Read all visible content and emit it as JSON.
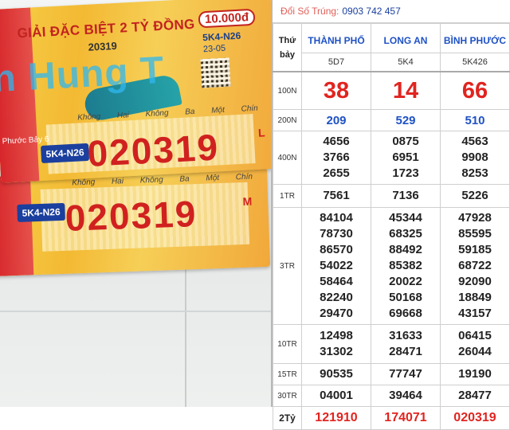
{
  "ticket": {
    "header": "GIẢI ĐẶC BIỆT 2 TỶ ĐỒNG",
    "price": "10.000đ",
    "code_small": "5K4-N26",
    "number_small": "20319",
    "date_partial": "23-05",
    "watermark": "n Hung T",
    "days": "Không Hai Không Ba Một Chín",
    "side_text": "Phước Bảy 6",
    "series": "5K4-N26",
    "number": "020319",
    "suffix_top": "L",
    "suffix_bottom": "M"
  },
  "results": {
    "title_label": "Đổi Số Trúng:",
    "phone": "0903 742 457",
    "day_label": "Thứ bảy",
    "provinces": [
      {
        "name": "THÀNH PHỐ",
        "code": "5D7"
      },
      {
        "name": "LONG AN",
        "code": "5K4"
      },
      {
        "name": "BÌNH PHƯỚC",
        "code": "5K426"
      }
    ],
    "prizes": [
      {
        "label": "100N",
        "values": [
          [
            "38"
          ],
          [
            "14"
          ],
          [
            "66"
          ]
        ]
      },
      {
        "label": "200N",
        "values": [
          [
            "209"
          ],
          [
            "529"
          ],
          [
            "510"
          ]
        ]
      },
      {
        "label": "400N",
        "values": [
          [
            "4656",
            "3766",
            "2655"
          ],
          [
            "0875",
            "6951",
            "1723"
          ],
          [
            "4563",
            "9908",
            "8253"
          ]
        ]
      },
      {
        "label": "1TR",
        "values": [
          [
            "7561"
          ],
          [
            "7136"
          ],
          [
            "5226"
          ]
        ]
      },
      {
        "label": "3TR",
        "values": [
          [
            "84104",
            "78730",
            "86570",
            "54022",
            "58464",
            "82240",
            "29470"
          ],
          [
            "45344",
            "68325",
            "88492",
            "85382",
            "20022",
            "50168",
            "69668"
          ],
          [
            "47928",
            "85595",
            "59185",
            "68722",
            "92090",
            "18849",
            "43157"
          ]
        ]
      },
      {
        "label": "10TR",
        "values": [
          [
            "12498",
            "31302"
          ],
          [
            "31633",
            "28471"
          ],
          [
            "06415",
            "26044"
          ]
        ]
      },
      {
        "label": "15TR",
        "values": [
          [
            "90535"
          ],
          [
            "77747"
          ],
          [
            "19190"
          ]
        ]
      },
      {
        "label": "30TR",
        "values": [
          [
            "04001"
          ],
          [
            "39464"
          ],
          [
            "28477"
          ]
        ]
      },
      {
        "label": "2Tỷ",
        "values": [
          [
            "121910"
          ],
          [
            "174071"
          ],
          [
            "020319"
          ]
        ]
      }
    ]
  }
}
